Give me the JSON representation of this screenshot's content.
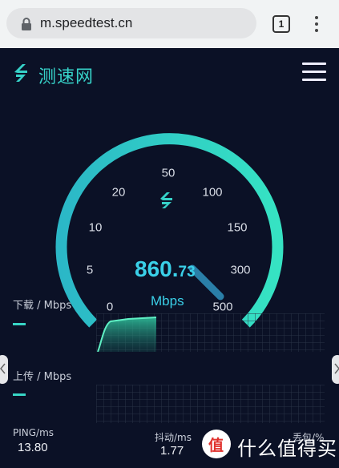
{
  "browser": {
    "url": "m.speedtest.cn",
    "tab_count": "1"
  },
  "app": {
    "brand": "测速网",
    "accent": "#36d1c8"
  },
  "gauge": {
    "ticks": [
      "0",
      "5",
      "10",
      "20",
      "50",
      "100",
      "150",
      "300",
      "500"
    ],
    "speed_int": "860.",
    "speed_dec": "73",
    "unit": "Mbps"
  },
  "download": {
    "label": "下载 / Mbps",
    "value": "—"
  },
  "upload": {
    "label": "上传 / Mbps",
    "value": "—"
  },
  "stats": {
    "ping_label": "PING/ms",
    "ping_value": "13.80",
    "jitter_label": "抖动/ms",
    "jitter_value": "1.77",
    "loss_label": "丢包/%"
  },
  "watermark": {
    "text": "什么值得买",
    "badge": "值"
  }
}
